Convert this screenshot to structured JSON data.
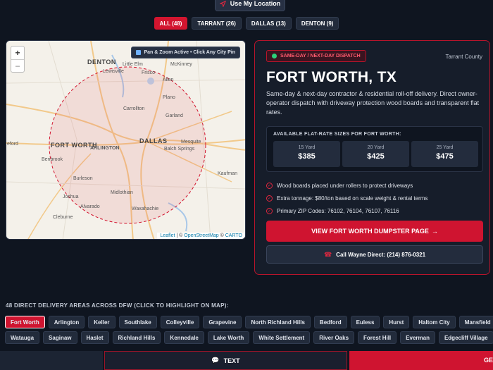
{
  "location_button": {
    "label": "Use My Location",
    "icon": "navigation-arrow-icon"
  },
  "filters": [
    {
      "label": "ALL (48)",
      "active": true
    },
    {
      "label": "TARRANT (26)",
      "active": false
    },
    {
      "label": "DALLAS (13)",
      "active": false
    },
    {
      "label": "DENTON (9)",
      "active": false
    }
  ],
  "map": {
    "zoom_in": "+",
    "zoom_out": "−",
    "hint": "Pan & Zoom Active • Click Any City Pin",
    "cities": {
      "denton": "DENTON",
      "mckinney": "McKinney",
      "lewisville": "Lewisville",
      "little_elm": "Little Elm",
      "frisco": "Frisco",
      "allen": "Allen",
      "plano": "Plano",
      "carrollton": "Carrollton",
      "garland": "Garland",
      "fort_worth": "FORT WORTH",
      "arlington": "ARLINGTON",
      "dallas": "DALLAS",
      "mesquite": "Mesquite",
      "balch_springs": "Balch Springs",
      "benbrook": "Benbrook",
      "kaufman": "Kaufman",
      "burleson": "Burleson",
      "midlothian": "Midlothian",
      "joshua": "Joshua",
      "alvarado": "Alvarado",
      "cleburne": "Cleburne",
      "waxahachie": "Waxahachie",
      "weatherford": "eford"
    },
    "attribution": {
      "leaflet": "Leaflet",
      "sep1": " | © ",
      "osm": "OpenStreetMap",
      "sep2": " © ",
      "carto": "CARTO"
    }
  },
  "detail": {
    "badge": "SAME-DAY / NEXT-DAY DISPATCH",
    "county": "Tarrant County",
    "city": "FORT WORTH, TX",
    "description": "Same-day & next-day contractor & residential roll-off delivery. Direct owner-operator dispatch with driveway protection wood boards and transparent flat rates.",
    "sizes_title": "AVAILABLE FLAT-RATE SIZES FOR FORT WORTH:",
    "sizes": [
      {
        "label": "15 Yard",
        "price": "$385"
      },
      {
        "label": "20 Yard",
        "price": "$425"
      },
      {
        "label": "25 Yard",
        "price": "$475"
      }
    ],
    "bullets": [
      "Wood boards placed under rollers to protect driveways",
      "Extra tonnage: $80/ton based on scale weight & rental terms",
      "Primary ZIP Codes: 76102, 76104, 76107, 76116"
    ],
    "cta": "VIEW FORT WORTH DUMPSTER PAGE",
    "cta_arrow": "→",
    "call": "Call Wayne Direct: (214) 876-0321"
  },
  "areas": {
    "title": "48 DIRECT DELIVERY AREAS ACROSS DFW (CLICK TO HIGHLIGHT ON MAP):",
    "row1": [
      "Fort Worth",
      "Arlington",
      "Keller",
      "Southlake",
      "Colleyville",
      "Grapevine",
      "North Richland Hills",
      "Bedford",
      "Euless",
      "Hurst",
      "Haltom City",
      "Mansfield"
    ],
    "row2": [
      "Watauga",
      "Saginaw",
      "Haslet",
      "Richland Hills",
      "Kennedale",
      "Lake Worth",
      "White Settlement",
      "River Oaks",
      "Forest Hill",
      "Everman",
      "Edgecliff Village"
    ],
    "active": "Fort Worth"
  },
  "bottom_bar": {
    "text_label": "TEXT",
    "get_label": "GE"
  },
  "colors": {
    "accent": "#cf1430",
    "background": "#0f1520",
    "card": "#161d2a"
  }
}
